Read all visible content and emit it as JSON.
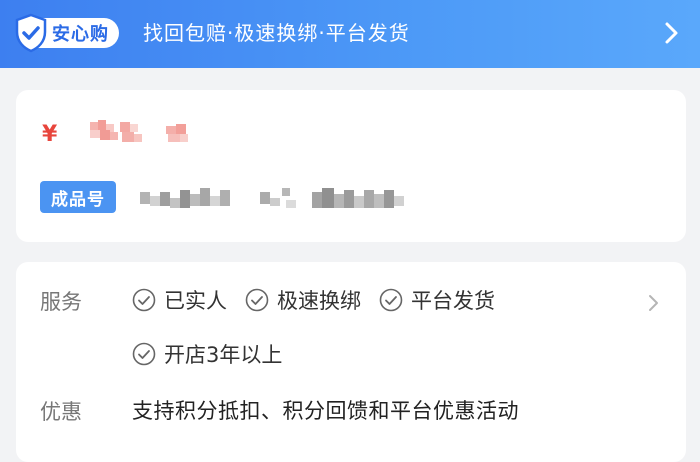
{
  "banner": {
    "badge_label": "安心购",
    "tagline": "找回包赔·极速换绑·平台发货",
    "brand_color": "#3d7ff0"
  },
  "listing": {
    "currency_symbol": "¥",
    "item_no_label": "成品号"
  },
  "service": {
    "label": "服务",
    "tags": [
      "已实人",
      "极速换绑",
      "平台发货",
      "开店3年以上"
    ]
  },
  "promo": {
    "label": "优惠",
    "text": "支持积分抵扣、积分回馈和平台优惠活动"
  },
  "colors": {
    "price": "#e8453c",
    "pill": "#4b94f2"
  }
}
